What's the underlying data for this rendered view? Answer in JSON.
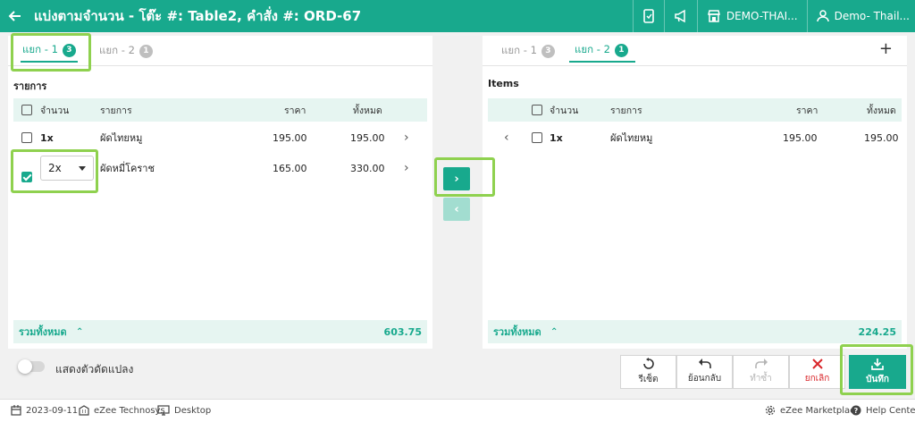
{
  "header": {
    "title": "แบ่งตามจำนวน - โต๊ะ #: Table2, คำสั่ง #: ORD-67",
    "property": "DEMO-THAI...",
    "user": "Demo- Thail..."
  },
  "left": {
    "tabs": [
      {
        "label": "แยก - 1",
        "count": "3"
      },
      {
        "label": "แยก - 2",
        "count": "1"
      }
    ],
    "section": "รายการ",
    "columns": {
      "qty": "จำนวน",
      "item": "รายการ",
      "price": "ราคา",
      "total": "ทั้งหมด"
    },
    "rows": [
      {
        "qty": "1x",
        "item": "ผัดไทยหมู",
        "price": "195.00",
        "total": "195.00"
      },
      {
        "qty": "2x",
        "item": "ผัดหมี่โคราช",
        "price": "165.00",
        "total": "330.00"
      }
    ],
    "total_label": "รวมทั้งหมด",
    "total_value": "603.75"
  },
  "right": {
    "tabs": [
      {
        "label": "แยก - 1",
        "count": "3"
      },
      {
        "label": "แยก - 2",
        "count": "1"
      }
    ],
    "add": "+",
    "section": "Items",
    "columns": {
      "qty": "จำนวน",
      "item": "รายการ",
      "price": "ราคา",
      "total": "ทั้งหมด"
    },
    "rows": [
      {
        "qty": "1x",
        "item": "ผัดไทยหมู",
        "price": "195.00",
        "total": "195.00"
      }
    ],
    "total_label": "รวมทั้งหมด",
    "total_value": "224.25"
  },
  "move": {
    "right": "›",
    "left": "‹"
  },
  "toggle_label": "แสดงตัวดัดแปลง",
  "actions": {
    "reset": "รีเซ็ต",
    "undo": "ย้อนกลับ",
    "redo": "ทำซ้ำ",
    "cancel": "ยกเลิก",
    "save": "บันทึก"
  },
  "footer": {
    "date": "2023-09-11",
    "company": "eZee Technosys",
    "device": "Desktop",
    "marketplace": "eZee Marketplace",
    "help": "Help Center"
  },
  "colors": {
    "brand": "#18a98d",
    "highlight": "#8fd14f",
    "cancel": "#d9262a"
  }
}
